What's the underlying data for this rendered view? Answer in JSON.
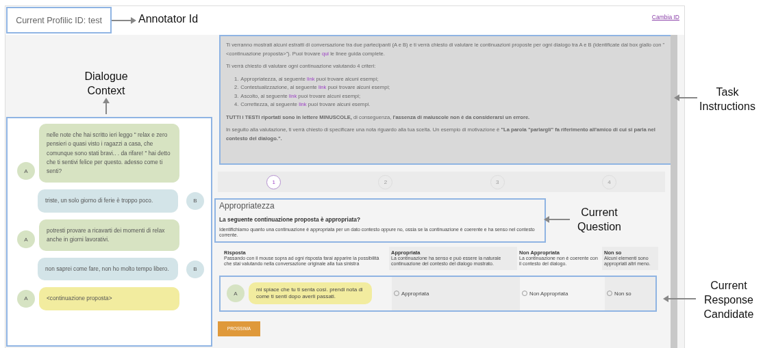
{
  "header": {
    "profile": "Current Profilic ID: test",
    "link": "Cambia ID"
  },
  "dialogue": [
    {
      "kind": "a-turn",
      "speaker": "A",
      "text": "nelle note che hai scritto ieri leggo \" relax e zero pensieri o quasi visto i ragazzi a casa, che comunque sono stati bravi.. . da rifare! \" hai detto che ti sentivi felice per questo. adesso come ti senti?"
    },
    {
      "kind": "b-turn",
      "speaker": "B",
      "text": "triste, un solo giorno di ferie è troppo poco."
    },
    {
      "kind": "a-turn",
      "speaker": "A",
      "text": "potresti provare a ricavarti dei momenti di relax anche in giorni lavorativi."
    },
    {
      "kind": "b-turn",
      "speaker": "B",
      "text": "non saprei come fare, non ho molto tempo libero."
    },
    {
      "kind": "proposal",
      "speaker": "A",
      "text": "<continuazione proposta>"
    }
  ],
  "instructions": {
    "paragraphs_top": [
      [
        {
          "kind": "text",
          "text": "Ti verranno mostrati alcuni estratti di conversazione tra due partecipanti (A e B) e ti verrà chiesto di valutare le continuazioni proposte per ogni dialogo tra A e B (identificate dal box giallo con \"<continuazione proposta>\"). Puoi trovare "
        },
        {
          "kind": "link",
          "text": "qui"
        },
        {
          "kind": "text",
          "text": " le linee guida complete."
        }
      ],
      [
        {
          "kind": "text",
          "text": "Ti verrà chiesto di valutare ogni continuazione valutando 4 criteri:"
        }
      ]
    ],
    "criteria": [
      {
        "number": "1.",
        "parts": [
          {
            "kind": "text",
            "text": "Appropriatezza, al seguente "
          },
          {
            "kind": "link",
            "text": "link"
          },
          {
            "kind": "text",
            "text": " puoi trovare alcuni esempi;"
          }
        ]
      },
      {
        "number": "2.",
        "parts": [
          {
            "kind": "text",
            "text": "Contestualizzazione, al seguente "
          },
          {
            "kind": "link",
            "text": "link"
          },
          {
            "kind": "text",
            "text": " puoi trovare alcuni esempi;"
          }
        ]
      },
      {
        "number": "3.",
        "parts": [
          {
            "kind": "text",
            "text": "Ascolto, al seguente "
          },
          {
            "kind": "link",
            "text": "link"
          },
          {
            "kind": "text",
            "text": " puoi trovare alcuni esempi;"
          }
        ]
      },
      {
        "number": "4.",
        "parts": [
          {
            "kind": "text",
            "text": "Correttezza, al seguente "
          },
          {
            "kind": "link",
            "text": "link"
          },
          {
            "kind": "text",
            "text": " puoi trovare alcuni esempi."
          }
        ]
      }
    ],
    "paragraphs_bottom": [
      [
        {
          "kind": "text",
          "text": "**TUTTI i TESTI riportati sono in lettere MINUSCOLE,** di conseguenza, **l'assenza di maiuscole non è da considerarsi un errore.**"
        }
      ],
      [
        {
          "kind": "text",
          "text": "In seguito alla valutazione, ti verrà chiesto di specificare una nota riguardo alla tua scelta. Un esempio di motivazione è **\"La parola \"parlargli\" fa riferimento all'amico di cui si parla nel contesto del dialogo.\".**"
        }
      ]
    ]
  },
  "steps": [
    {
      "label": "1",
      "selected": true
    },
    {
      "label": "2",
      "selected": false
    },
    {
      "label": "3",
      "selected": false
    },
    {
      "label": "4",
      "selected": false
    }
  ],
  "question": {
    "title": "Appropriatezza",
    "prompt": "La seguente continuazione proposta è appropriata?",
    "description": "Identifichiamo quanto una continuazione è appropriata per un dato contesto oppure no, ossia se la continuazione è coerente e ha senso nel contesto corrente."
  },
  "table": {
    "columns": [
      {
        "title": "Risposta",
        "description": "Passando con il mouse sopra ad ogni risposta farai apparire la possibilità che stai valutando nella conversazione originale alla tua sinistra"
      },
      {
        "title": "Appropriata",
        "description": "La continuazione ha senso e può essere la naturale continuazione del contesto del dialogo mostrato."
      },
      {
        "title": "Non Appropriata",
        "description": "La continuazione non è coerente con il contesto del dialogo."
      },
      {
        "title": "Non so",
        "description": "Alcuni elementi sono appropriati altri meno."
      }
    ],
    "row": {
      "speaker": "A",
      "text": "mi spiace che tu ti senta così. prendi nota di come ti senti dopo averli passati.",
      "options": [
        {
          "label": "Appropriata",
          "checked": false
        },
        {
          "label": "Non Appropriata",
          "checked": false
        },
        {
          "label": "Non so",
          "checked": false
        }
      ]
    }
  },
  "next_button": "PROSSIMA",
  "annotations": [
    {
      "label": "Annotator Id"
    },
    {
      "label": "Dialogue Context"
    },
    {
      "label": "Task Instructions"
    },
    {
      "label": "Current Question"
    },
    {
      "label": "Current Response Candidate"
    }
  ]
}
